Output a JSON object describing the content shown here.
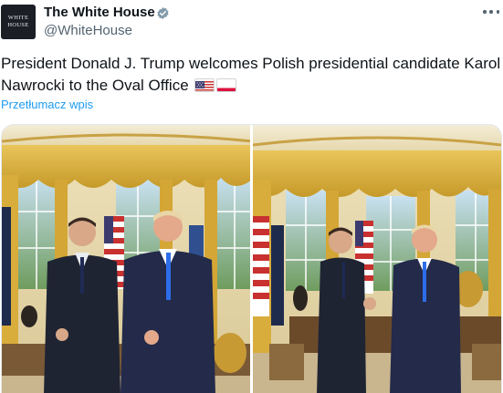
{
  "author": {
    "name": "The White House",
    "handle": "@WhiteHouse",
    "avatar_text_line1": "WHITE",
    "avatar_text_line2": "HOUSE"
  },
  "tweet": {
    "text": "President Donald J. Trump welcomes Polish presidential candidate Karol Nawrocki to the Oval Office",
    "translate_label": "Przetłumacz wpis"
  },
  "icons": {
    "verified": "verified-badge-icon",
    "more": "more-options-icon",
    "flag_us": "us-flag-icon",
    "flag_pl": "poland-flag-icon"
  },
  "colors": {
    "accent": "#1d9bf0",
    "verified_badge": "#829aab",
    "text_primary": "#0f1419",
    "text_secondary": "#536471"
  }
}
